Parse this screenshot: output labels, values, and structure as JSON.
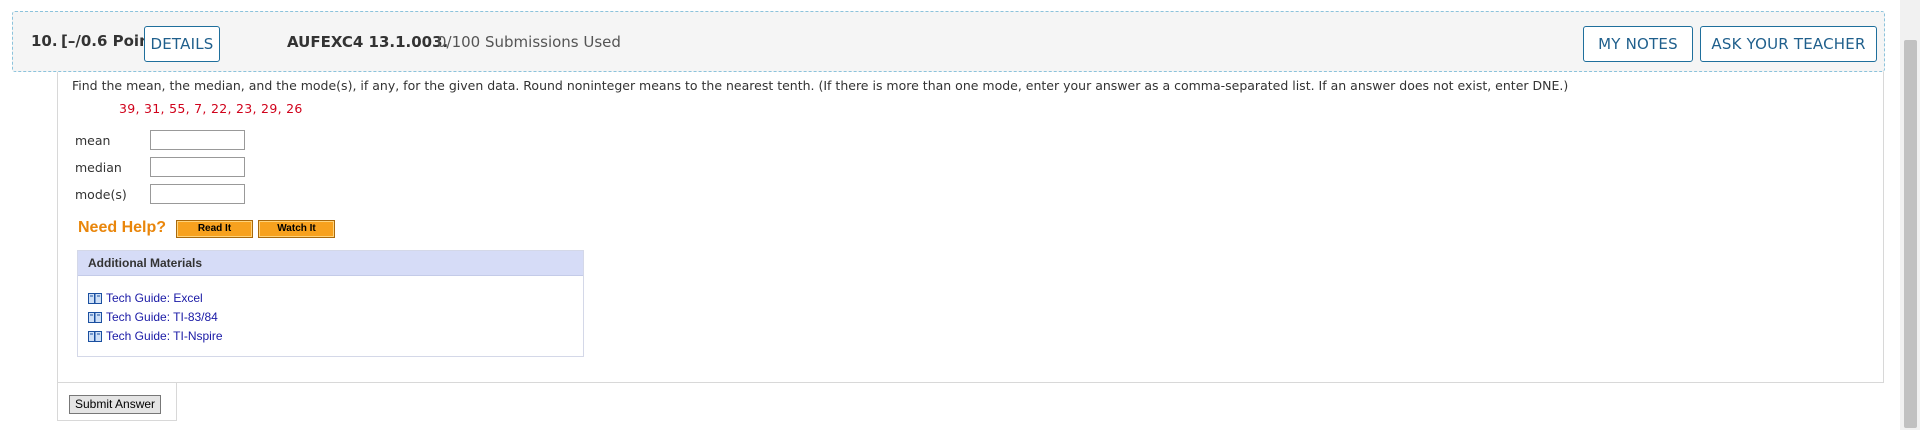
{
  "header": {
    "number": "10.",
    "points": "[–/0.6 Points]",
    "details_label": "DETAILS",
    "code": "AUFEXC4 13.1.003.",
    "submissions": "0/100 Submissions Used",
    "my_notes_label": "MY NOTES",
    "ask_teacher_label": "ASK YOUR TEACHER"
  },
  "question": {
    "prompt": "Find the mean, the median, and the mode(s), if any, for the given data. Round noninteger means to the nearest tenth. (If there is more than one mode, enter your answer as a comma-separated list. If an answer does not exist, enter DNE.)",
    "data": "39, 31, 55, 7, 22, 23, 29, 26",
    "fields": [
      {
        "label": "mean",
        "value": ""
      },
      {
        "label": "median",
        "value": ""
      },
      {
        "label": "mode(s)",
        "value": ""
      }
    ]
  },
  "help": {
    "title": "Need Help?",
    "read_label": "Read It",
    "watch_label": "Watch It"
  },
  "materials": {
    "title": "Additional Materials",
    "links": [
      "Tech Guide: Excel",
      "Tech Guide: TI-83/84",
      "Tech Guide: TI-Nspire"
    ],
    "icon": "book-icon"
  },
  "submit_label": "Submit Answer",
  "colors": {
    "accent": "#1f6f9c",
    "data_red": "#d0021b",
    "help_orange": "#e9860b",
    "link_blue": "#1a1aa6"
  }
}
